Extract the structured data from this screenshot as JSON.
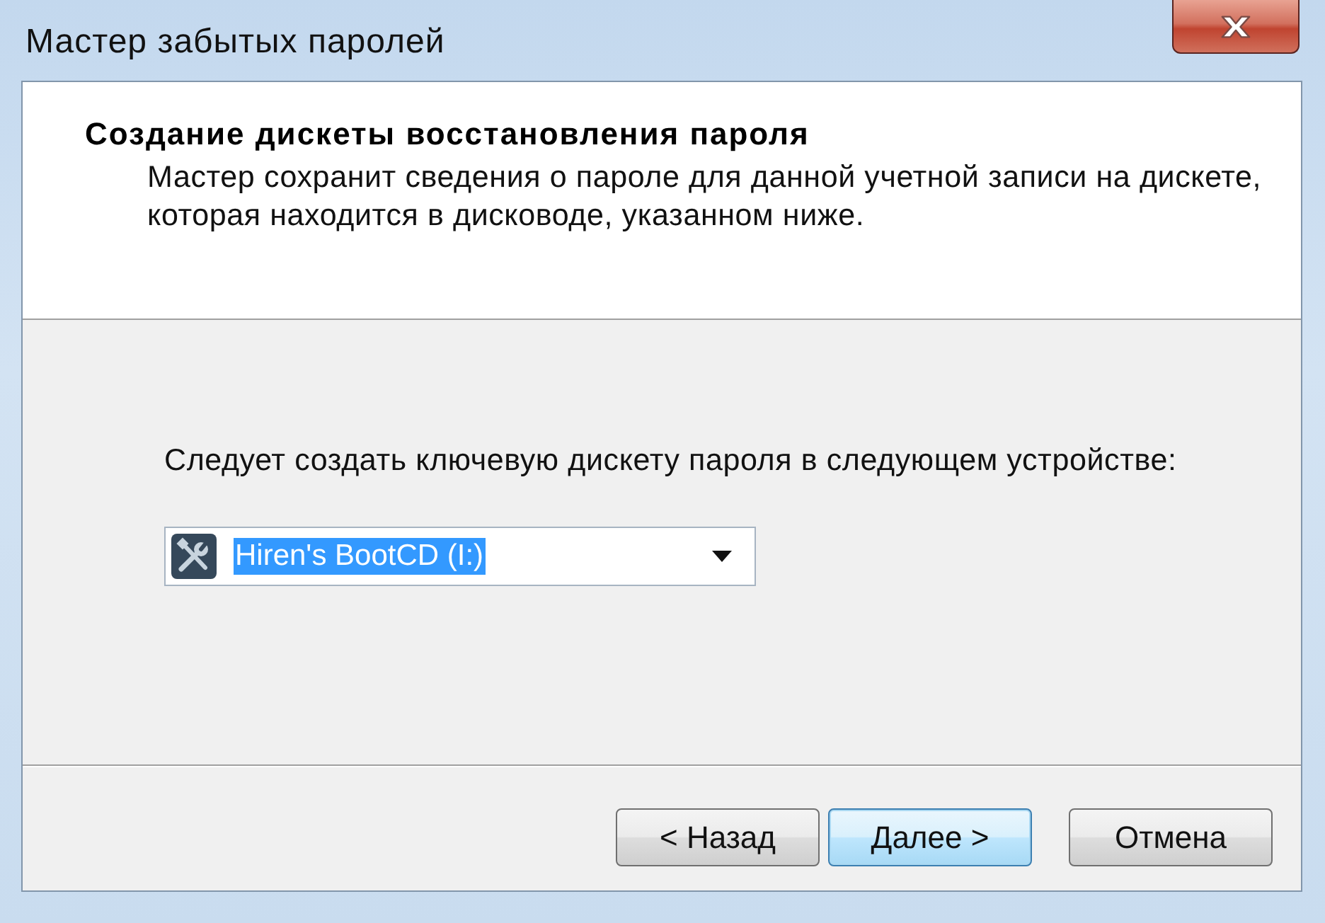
{
  "window": {
    "title": "Мастер забытых паролей"
  },
  "header": {
    "title": "Создание дискеты восстановления пароля",
    "description": "Мастер сохранит сведения о пароле для данной учетной записи на дискете, которая находится в дисководе, указанном ниже."
  },
  "body": {
    "label": "Следует создать ключевую дискету пароля в следующем устройстве:",
    "drive_select": {
      "value": "Hiren's BootCD (I:)",
      "highlighted": true
    }
  },
  "buttons": [
    {
      "label": "< Назад",
      "focused": false
    },
    {
      "label": "Далее >",
      "focused": true
    },
    {
      "label": "Отмена",
      "focused": false
    }
  ]
}
